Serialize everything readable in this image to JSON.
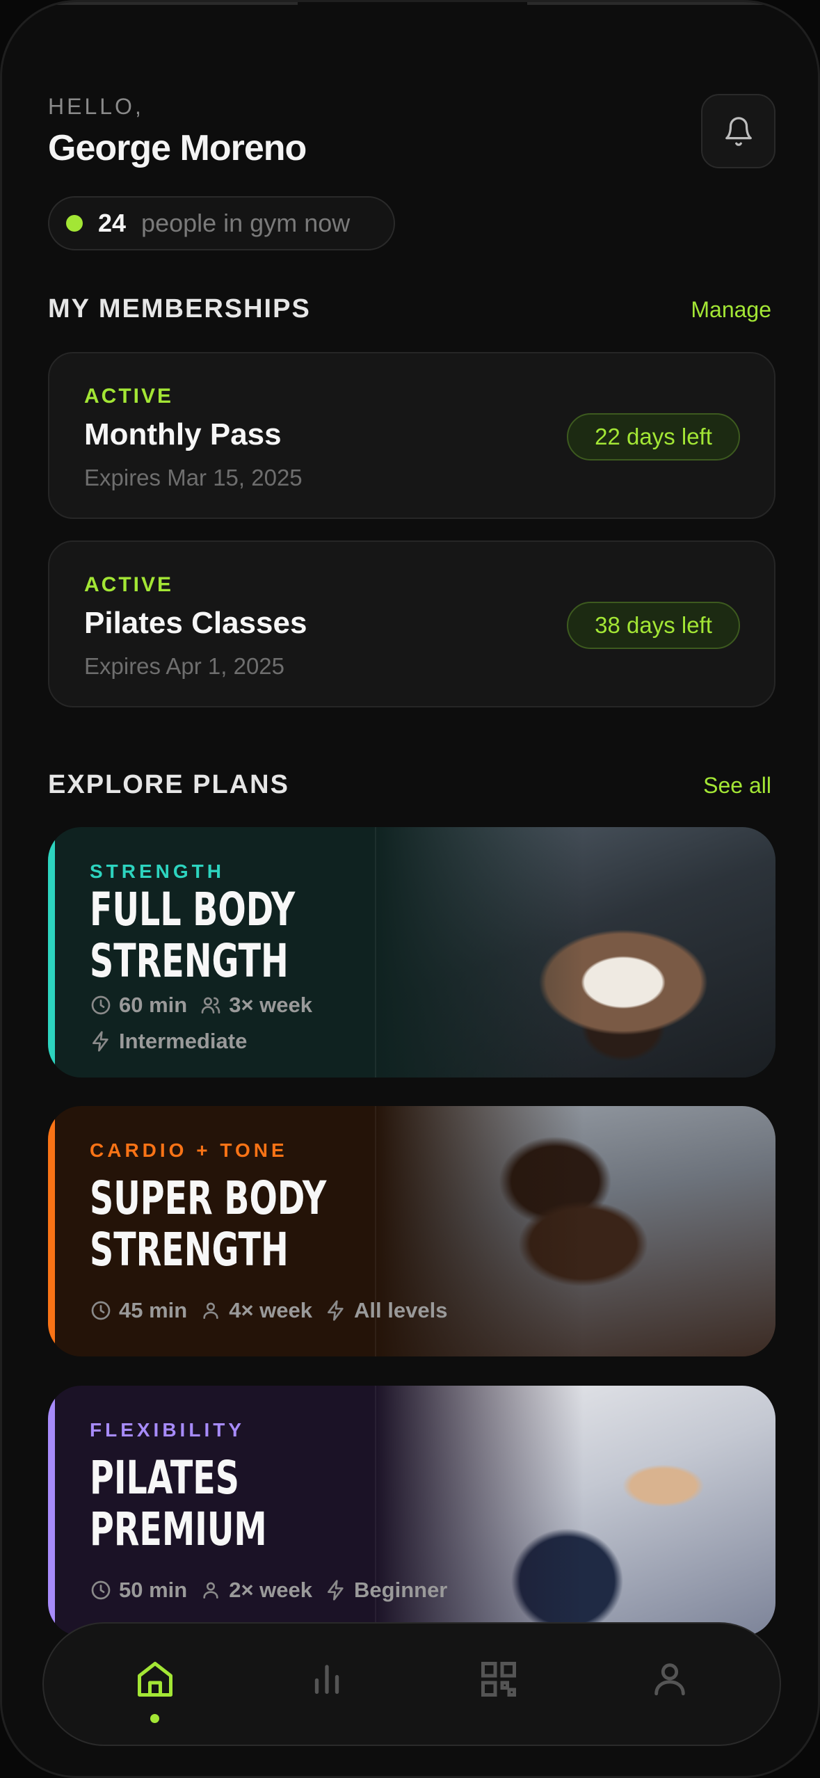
{
  "header": {
    "greeting": "HELLO,",
    "user_name": "George Moreno",
    "gym_count": "24",
    "gym_text": "people in gym now"
  },
  "memberships": {
    "title": "MY MEMBERSHIPS",
    "action": "Manage",
    "items": [
      {
        "status": "ACTIVE",
        "name": "Monthly Pass",
        "expires": "Expires Mar 15, 2025",
        "days_left": "22 days left"
      },
      {
        "status": "ACTIVE",
        "name": "Pilates Classes",
        "expires": "Expires Apr 1, 2025",
        "days_left": "38 days left"
      }
    ]
  },
  "plans": {
    "title": "EXPLORE PLANS",
    "action": "See all",
    "items": [
      {
        "category": "STRENGTH",
        "title_line1": "FULL BODY",
        "title_line2": "STRENGTH",
        "duration": "60 min",
        "frequency": "3× week",
        "level": "Intermediate",
        "accent": "#2dd4bf"
      },
      {
        "category": "CARDIO + TONE",
        "title_line1": "SUPER BODY",
        "title_line2": "STRENGTH",
        "duration": "45 min",
        "frequency": "4× week",
        "level": "All levels",
        "accent": "#f97316"
      },
      {
        "category": "FLEXIBILITY",
        "title_line1": "PILATES",
        "title_line2": "PREMIUM",
        "duration": "50 min",
        "frequency": "2× week",
        "level": "Beginner",
        "accent": "#a78bfa"
      }
    ]
  },
  "nav": {
    "items": [
      "home-icon",
      "stats-icon",
      "qr-icon",
      "profile-icon"
    ],
    "active": "home"
  },
  "colors": {
    "accent": "#a3e635",
    "background": "#0d0d0d"
  }
}
